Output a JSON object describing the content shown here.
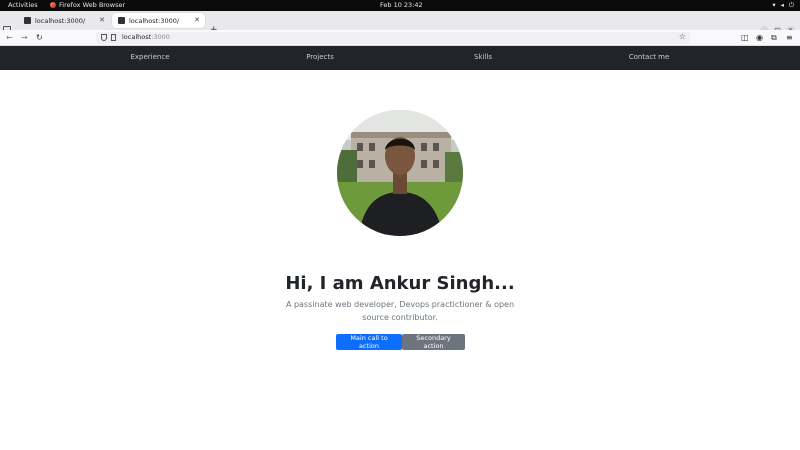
{
  "os_topbar": {
    "activities": "Activities",
    "app_name": "Firefox Web Browser",
    "clock": "Feb 10  23:42"
  },
  "browser": {
    "tabs": [
      {
        "title": "localhost:3000/"
      },
      {
        "title": "localhost:3000/",
        "active": true
      }
    ],
    "url_host": "localhost",
    "url_port": ":3000"
  },
  "site_nav": {
    "items": [
      {
        "label": "Experience"
      },
      {
        "label": "Projects"
      },
      {
        "label": "Skills"
      },
      {
        "label": "Contact me"
      }
    ]
  },
  "hero": {
    "title": "Hi, I am Ankur Singh...",
    "subtitle": "A passinate web developer, Devops practictioner & open source contributor.",
    "primary_button": "Main call to action",
    "secondary_button": "Secondary action"
  },
  "colors": {
    "navbar_bg": "#212529",
    "primary": "#0d6efd",
    "secondary": "#6c757d"
  }
}
